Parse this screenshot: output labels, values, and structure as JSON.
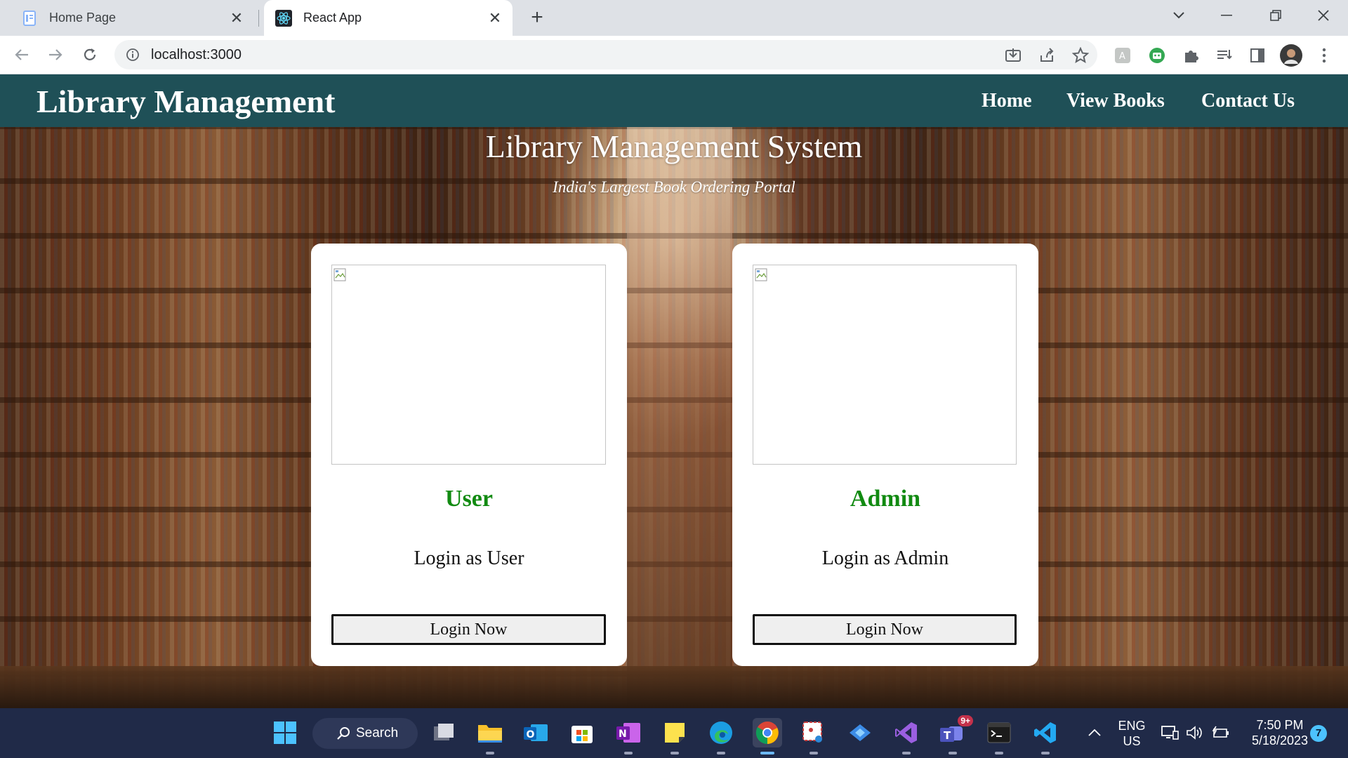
{
  "browser": {
    "tabs": [
      {
        "title": "Home Page",
        "icon": "document-icon",
        "active": false
      },
      {
        "title": "React App",
        "icon": "react-icon",
        "active": true
      }
    ],
    "address": "localhost:3000"
  },
  "navbar": {
    "brand": "Library Management",
    "links": [
      "Home",
      "View Books",
      "Contact Us"
    ],
    "bg_color": "#1f5057"
  },
  "hero": {
    "title": "Library Management System",
    "subtitle": "India's Largest Book Ordering Portal"
  },
  "cards": [
    {
      "heading": "User",
      "description": "Login as User",
      "button": "Login Now"
    },
    {
      "heading": "Admin",
      "description": "Login as Admin",
      "button": "Login Now"
    }
  ],
  "accent_color": "#118a11",
  "taskbar": {
    "search_label": "Search",
    "language": "ENG",
    "region": "US",
    "time": "7:50 PM",
    "date": "5/18/2023",
    "notification_count": "7",
    "teams_badge": "9+"
  }
}
